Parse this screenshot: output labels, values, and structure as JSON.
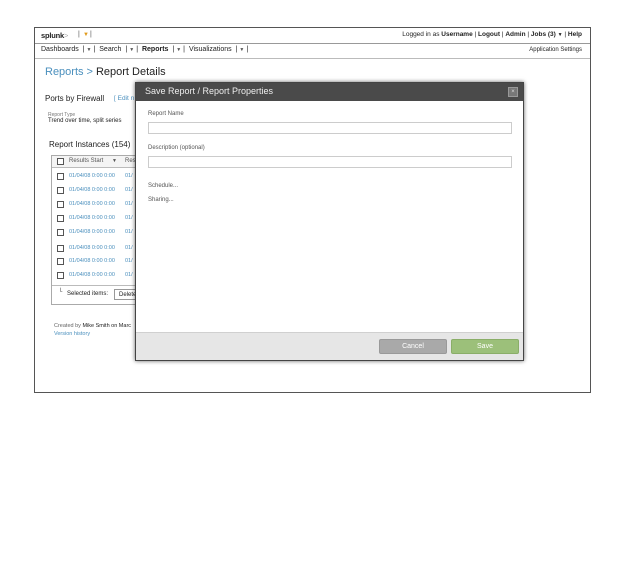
{
  "header": {
    "logo": "splunk",
    "logo_suffix": ">",
    "logged_in_prefix": "Logged in as",
    "username": "Username",
    "logout": "Logout",
    "admin": "Admin",
    "jobs": "Jobs (3)",
    "help": "Help"
  },
  "nav": {
    "dashboards": "Dashboards",
    "search": "Search",
    "reports": "Reports",
    "visualizations": "Visualizations",
    "app_settings": "Application Settings"
  },
  "breadcrumb": {
    "parent": "Reports",
    "separator": ">",
    "current": "Report Details"
  },
  "report": {
    "name": "Ports by Firewall",
    "edit_link": "[ Edit n",
    "type_label": "Report Type",
    "type_value": "Trend over time, split series"
  },
  "instances": {
    "title": "Report Instances (154)",
    "columns": [
      "Results Start",
      "Resu"
    ],
    "rows": [
      {
        "start": "01/04/08 0:00 0:00",
        "result": "01/"
      },
      {
        "start": "01/04/08 0:00 0:00",
        "result": "01/"
      },
      {
        "start": "01/04/08 0:00 0:00",
        "result": "01/"
      },
      {
        "start": "01/04/08 0:00 0:00",
        "result": "01/"
      },
      {
        "start": "01/04/08 0:00 0:00",
        "result": "01/"
      },
      {
        "start": "01/04/08 0:00 0:00",
        "result": "01/"
      },
      {
        "start": "01/04/08 0:00 0:00",
        "result": "01/"
      },
      {
        "start": "01/04/08 0:00 0:00",
        "result": "01/"
      }
    ],
    "selected_label": "Selected items:",
    "delete_label": "Delete"
  },
  "footer_info": {
    "created_prefix": "Created by",
    "author": "Mike Smith on Marc",
    "version_history": "Version history"
  },
  "modal": {
    "title": "Save Report / Report Properties",
    "close": "×",
    "name_label": "Report Name",
    "name_value": "",
    "desc_label": "Description (optional)",
    "desc_value": "",
    "schedule": "Schedule...",
    "sharing": "Sharing...",
    "cancel": "Cancel",
    "save": "Save"
  },
  "colors": {
    "link": "#4a8fbd",
    "modal_header": "#4a4a4a",
    "save_button": "#9cc07a",
    "cancel_button": "#a9a9a9",
    "jobs_caret": "#e09a1a"
  }
}
